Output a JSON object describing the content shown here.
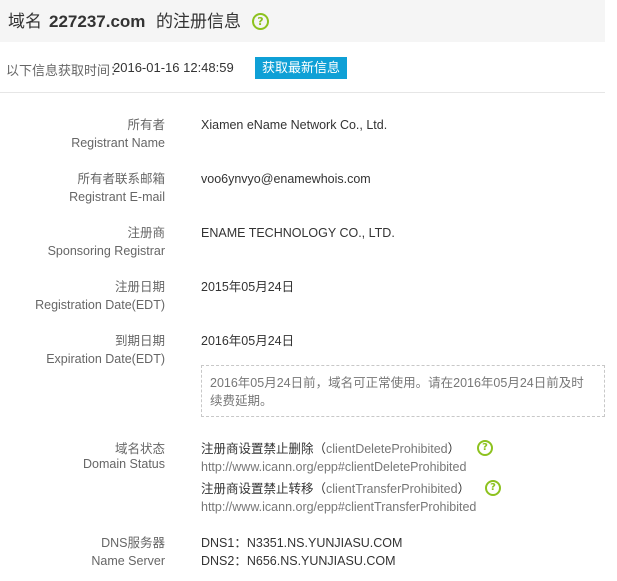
{
  "header": {
    "prefix": "域名",
    "domain": "227237.com",
    "suffix": "的注册信息",
    "help_icon": "question-circle-icon",
    "help_glyph": "?"
  },
  "fetch": {
    "label": "以下信息获取时间：",
    "time": "2016-01-16 12:48:59",
    "button_label": "获取最新信息"
  },
  "fields": {
    "registrant_name": {
      "label_cn": "所有者",
      "label_en": "Registrant Name",
      "value": "Xiamen eName Network Co., Ltd."
    },
    "registrant_email": {
      "label_cn": "所有者联系邮箱",
      "label_en": "Registrant E-mail",
      "value": "voo6ynvyo@enamewhois.com"
    },
    "registrar": {
      "label_cn": "注册商",
      "label_en": "Sponsoring Registrar",
      "value": "ENAME TECHNOLOGY CO., LTD."
    },
    "registration_date": {
      "label_cn": "注册日期",
      "label_en": "Registration Date(EDT)",
      "value": "2015年05月24日"
    },
    "expiration_date": {
      "label_cn": "到期日期",
      "label_en": "Expiration Date(EDT)",
      "value": "2016年05月24日"
    }
  },
  "notice": "2016年05月24日前，域名可正常使用。请在2016年05月24日前及时续费延期。",
  "domain_status": {
    "label_cn": "域名状态",
    "label_en": "Domain Status",
    "items": [
      {
        "cn": "注册商设置禁止删除（",
        "code": "clientDeleteProhibited",
        "close": "）",
        "url": "http://www.icann.org/epp#clientDeleteProhibited"
      },
      {
        "cn": "注册商设置禁止转移（",
        "code": "clientTransferProhibited",
        "close": "）",
        "url": "http://www.icann.org/epp#clientTransferProhibited"
      }
    ]
  },
  "dns": {
    "label_cn": "DNS服务器",
    "label_en": "Name Server",
    "servers": [
      "DNS1：N3351.NS.YUNJIASU.COM",
      "DNS2：N656.NS.YUNJIASU.COM"
    ]
  },
  "colors": {
    "accent_button": "#0fa0d6",
    "help_icon": "#8dc21f"
  }
}
